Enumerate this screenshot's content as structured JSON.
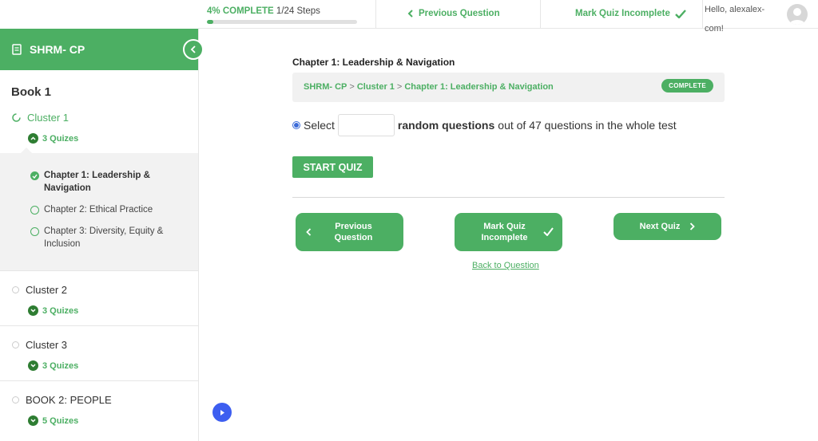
{
  "topbar": {
    "progress_pct_label": "4% COMPLETE",
    "progress_steps": "1/24 Steps",
    "progress_fraction": 0.04,
    "previous_question": "Previous Question",
    "mark_incomplete": "Mark Quiz Incomplete",
    "hello": "Hello, alexalex-com!"
  },
  "sidebar": {
    "course_title": "SHRM- CP",
    "book1": "Book 1",
    "clusters": [
      {
        "label": "Cluster 1",
        "quizzes": "3 Quizes"
      },
      {
        "label": "Cluster 2",
        "quizzes": "3 Quizes"
      },
      {
        "label": "Cluster 3",
        "quizzes": "3 Quizes"
      },
      {
        "label": "BOOK 2: PEOPLE",
        "quizzes": "5 Quizes"
      }
    ],
    "lessons": [
      {
        "label": "Chapter 1: Leadership & Navigation",
        "status": "complete"
      },
      {
        "label": "Chapter 2: Ethical Practice",
        "status": "open"
      },
      {
        "label": "Chapter 3: Diversity, Equity & Inclusion",
        "status": "open"
      }
    ]
  },
  "main": {
    "chapter_title": "Chapter 1: Leadership & Navigation",
    "breadcrumb": [
      "SHRM- CP",
      "Cluster 1",
      "Chapter 1: Leadership & Navigation"
    ],
    "breadcrumb_sep": ">",
    "complete_badge": "COMPLETE",
    "select_prefix": "Select",
    "select_bold": "random questions",
    "select_suffix": "out of 47 questions in the whole test",
    "start_quiz": "START QUIZ",
    "previous_question_line1": "Previous",
    "previous_question_line2": "Question",
    "mark_incomplete_line1": "Mark Quiz",
    "mark_incomplete_line2": "Incomplete",
    "next_quiz": "Next Quiz",
    "back_to_question": "Back to Question"
  },
  "colors": {
    "accent": "#4caf63",
    "play": "#3d5ef0"
  }
}
